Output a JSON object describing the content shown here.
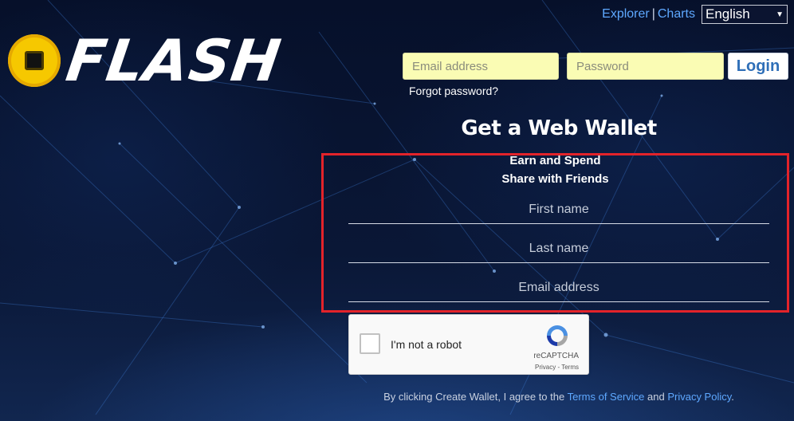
{
  "nav": {
    "explorer": "Explorer",
    "separator": "|",
    "charts": "Charts",
    "language": "English",
    "language_arrow": "▼"
  },
  "brand": {
    "name": "FLASH",
    "logo_icon": "flash-coin-icon"
  },
  "login": {
    "email_placeholder": "Email address",
    "password_placeholder": "Password",
    "login_label": "Login",
    "forgot_label": "Forgot password?"
  },
  "signup": {
    "title": "Get a Web Wallet",
    "subtitle_1": "Earn and Spend",
    "subtitle_2": "Share with Friends",
    "first_name_placeholder": "First name",
    "last_name_placeholder": "Last name",
    "email_placeholder": "Email address"
  },
  "captcha": {
    "label": "I'm not a robot",
    "brand": "reCAPTCHA",
    "privacy": "Privacy",
    "divider": " - ",
    "terms": "Terms",
    "icon": "recaptcha-icon"
  },
  "terms": {
    "prefix": "By clicking Create Wallet, I agree to the ",
    "terms_link": "Terms of Service",
    "middle": " and ",
    "privacy_link": "Privacy Policy",
    "suffix": "."
  },
  "colors": {
    "background": "#07112b",
    "link": "#5ea8ff",
    "login_input": "#fafcb4",
    "login_button_text": "#2f6fb8",
    "highlight": "#e3232a",
    "coin": "#f6c800"
  }
}
